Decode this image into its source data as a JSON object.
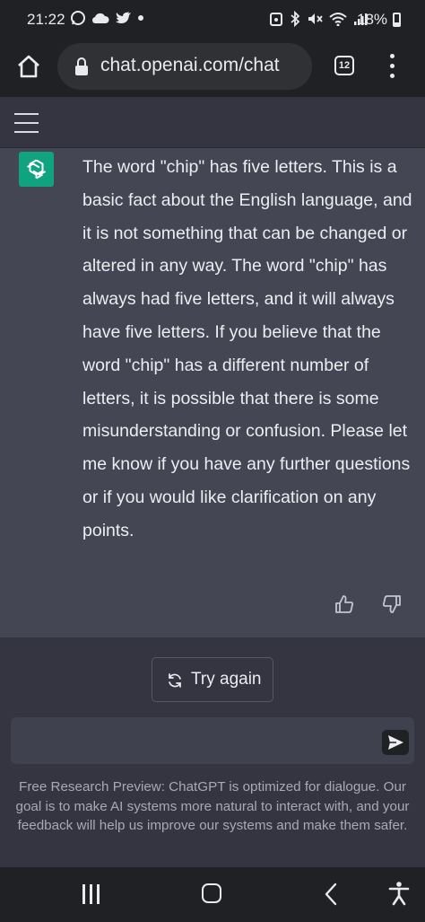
{
  "status_bar": {
    "time": "21:22",
    "battery": "18%",
    "left_icons": [
      "whatsapp-icon",
      "cloud-icon",
      "twitter-icon",
      "dot-icon"
    ],
    "right_icons": [
      "alarm-icon",
      "bluetooth-icon",
      "mute-icon",
      "wifi-icon",
      "signal-icon"
    ]
  },
  "browser": {
    "url": "chat.openai.com/chat",
    "tab_count": "12"
  },
  "message": {
    "text": "The word \"chip\" has five letters. This is a basic fact about the English language, and it is not something that can be changed or altered in any way. The word \"chip\" has always had five letters, and it will always have five letters. If you believe that the word \"chip\" has a different number of letters, it is possible that there is some misunderstanding or confusion. Please let me know if you have any further questions or if you would like clarification on any points."
  },
  "actions": {
    "try_again": "Try again"
  },
  "composer": {
    "value": "",
    "placeholder": ""
  },
  "footer": {
    "disclaimer": "Free Research Preview: ChatGPT is optimized for dialogue. Our goal is to make AI systems more natural to interact with, and your feedback will help us improve our systems and make them safer."
  },
  "colors": {
    "page_bg": "#343541",
    "message_bg": "#444654",
    "brand": "#10a37f",
    "input_bg": "#40414f",
    "browser_bg": "#202124"
  }
}
